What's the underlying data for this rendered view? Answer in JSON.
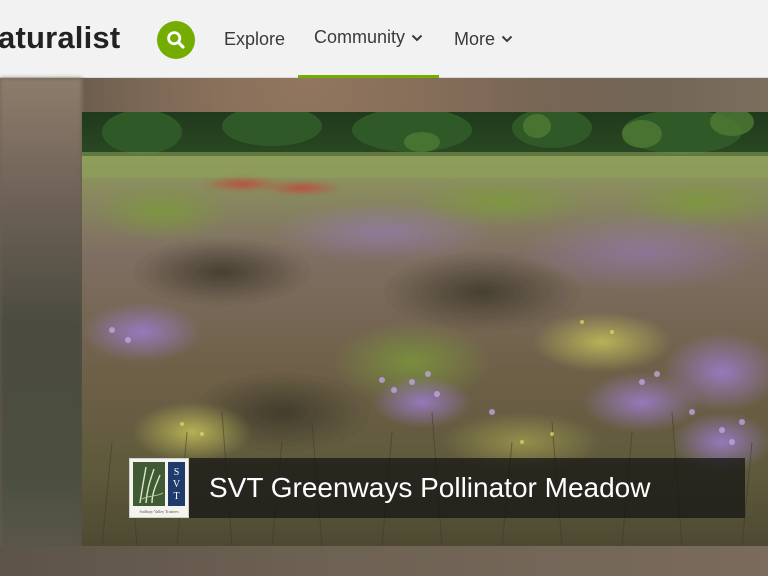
{
  "header": {
    "logo_text": "aturalist",
    "search_icon": "search-icon",
    "nav": {
      "explore": "Explore",
      "community": "Community",
      "more": "More"
    },
    "accent_color": "#74ac00"
  },
  "project": {
    "title": "SVT Greenways Pollinator Meadow",
    "logo_lettering": "SVT",
    "logo_subtext": "Sudbury Valley Trustees"
  }
}
